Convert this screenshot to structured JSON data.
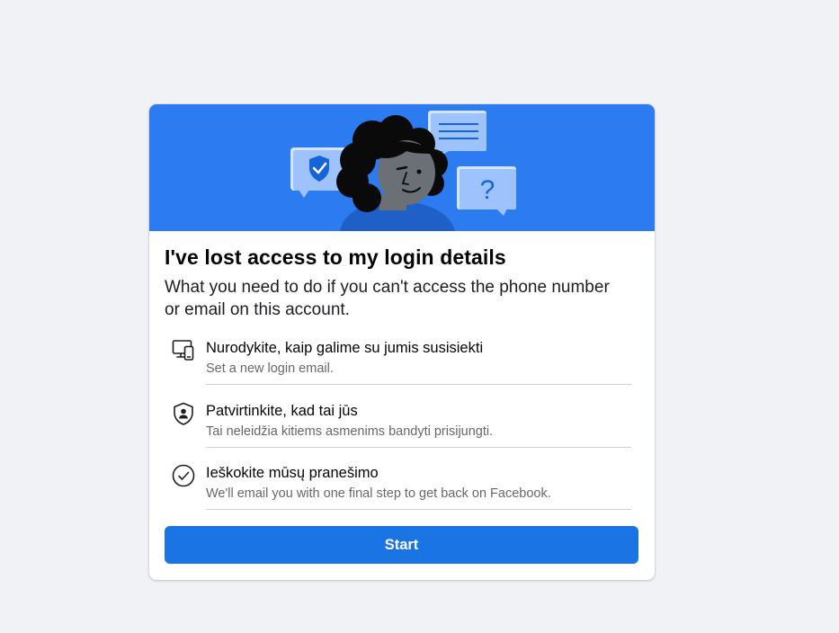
{
  "card": {
    "title": "I've lost access to my login details",
    "subtitle": "What you need to do if you can't access the phone number or email on this account.",
    "steps": [
      {
        "icon": "devices-icon",
        "label": "Nurodykite, kaip galime su jumis susisiekti",
        "description": "Set a new login email."
      },
      {
        "icon": "shield-person-icon",
        "label": "Patvirtinkite, kad tai jūs",
        "description": "Tai neleidžia kitiems asmenims bandyti prisijungti."
      },
      {
        "icon": "check-circle-icon",
        "label": "Ieškokite mūsų pranešimo",
        "description": "We'll email you with one final step to get back on Facebook."
      }
    ],
    "start_label": "Start"
  },
  "hero": {
    "illustration_icons": [
      "shield-check-bubble-icon",
      "message-bubble-icon",
      "question-bubble-icon"
    ],
    "question_mark": "?"
  },
  "colors": {
    "page_background": "#f0f2f5",
    "hero_background": "#2d7bf0",
    "primary_button": "#1b74e4",
    "secondary_text": "#65676b",
    "divider": "#ced0d4"
  }
}
